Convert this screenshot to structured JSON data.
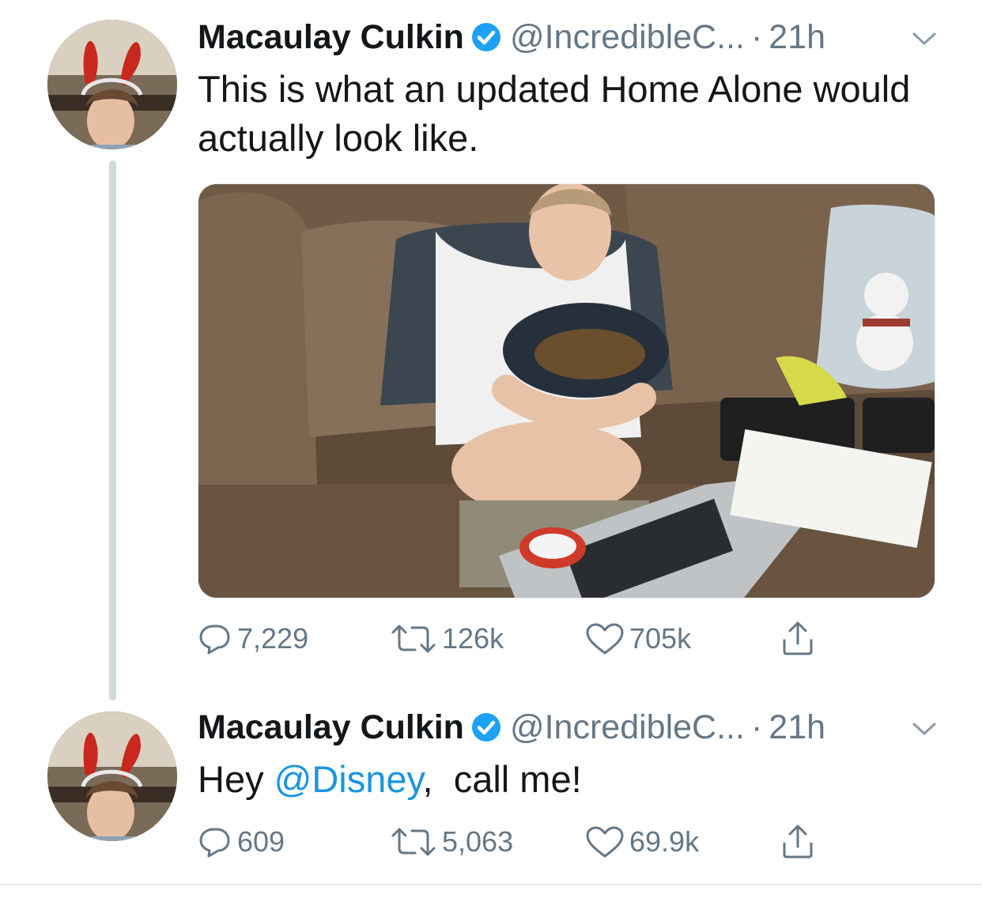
{
  "tweets": [
    {
      "name": "Macaulay Culkin",
      "handle": "@IncredibleC...",
      "separator": "·",
      "time": "21h",
      "text": "This is what an updated Home Alone would actually look like.",
      "has_media": true,
      "stats": {
        "replies": "7,229",
        "retweets": "126k",
        "likes": "705k"
      }
    },
    {
      "name": "Macaulay Culkin",
      "handle": "@IncredibleC...",
      "separator": "·",
      "time": "21h",
      "text_before": "Hey ",
      "mention": "@Disney",
      "text_after": ",  call me!",
      "has_media": false,
      "stats": {
        "replies": "609",
        "retweets": "5,063",
        "likes": "69.9k"
      }
    }
  ],
  "colors": {
    "primary_text": "#14171a",
    "secondary_text": "#657786",
    "link": "#1b95e0",
    "verified": "#1da1f2",
    "thread_line": "#cfd9de"
  },
  "icons": [
    "verified-badge-icon",
    "chevron-down-icon",
    "reply-icon",
    "retweet-icon",
    "like-icon",
    "share-icon"
  ]
}
